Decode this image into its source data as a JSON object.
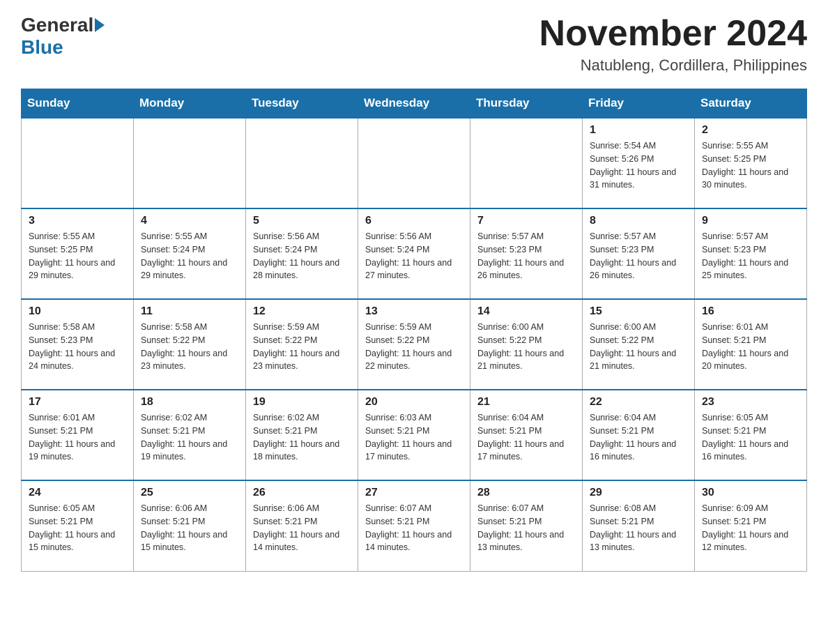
{
  "header": {
    "logo_general": "General",
    "logo_blue": "Blue",
    "month_title": "November 2024",
    "location": "Natubleng, Cordillera, Philippines"
  },
  "days_of_week": [
    "Sunday",
    "Monday",
    "Tuesday",
    "Wednesday",
    "Thursday",
    "Friday",
    "Saturday"
  ],
  "weeks": [
    [
      {
        "day": "",
        "sunrise": "",
        "sunset": "",
        "daylight": ""
      },
      {
        "day": "",
        "sunrise": "",
        "sunset": "",
        "daylight": ""
      },
      {
        "day": "",
        "sunrise": "",
        "sunset": "",
        "daylight": ""
      },
      {
        "day": "",
        "sunrise": "",
        "sunset": "",
        "daylight": ""
      },
      {
        "day": "",
        "sunrise": "",
        "sunset": "",
        "daylight": ""
      },
      {
        "day": "1",
        "sunrise": "Sunrise: 5:54 AM",
        "sunset": "Sunset: 5:26 PM",
        "daylight": "Daylight: 11 hours and 31 minutes."
      },
      {
        "day": "2",
        "sunrise": "Sunrise: 5:55 AM",
        "sunset": "Sunset: 5:25 PM",
        "daylight": "Daylight: 11 hours and 30 minutes."
      }
    ],
    [
      {
        "day": "3",
        "sunrise": "Sunrise: 5:55 AM",
        "sunset": "Sunset: 5:25 PM",
        "daylight": "Daylight: 11 hours and 29 minutes."
      },
      {
        "day": "4",
        "sunrise": "Sunrise: 5:55 AM",
        "sunset": "Sunset: 5:24 PM",
        "daylight": "Daylight: 11 hours and 29 minutes."
      },
      {
        "day": "5",
        "sunrise": "Sunrise: 5:56 AM",
        "sunset": "Sunset: 5:24 PM",
        "daylight": "Daylight: 11 hours and 28 minutes."
      },
      {
        "day": "6",
        "sunrise": "Sunrise: 5:56 AM",
        "sunset": "Sunset: 5:24 PM",
        "daylight": "Daylight: 11 hours and 27 minutes."
      },
      {
        "day": "7",
        "sunrise": "Sunrise: 5:57 AM",
        "sunset": "Sunset: 5:23 PM",
        "daylight": "Daylight: 11 hours and 26 minutes."
      },
      {
        "day": "8",
        "sunrise": "Sunrise: 5:57 AM",
        "sunset": "Sunset: 5:23 PM",
        "daylight": "Daylight: 11 hours and 26 minutes."
      },
      {
        "day": "9",
        "sunrise": "Sunrise: 5:57 AM",
        "sunset": "Sunset: 5:23 PM",
        "daylight": "Daylight: 11 hours and 25 minutes."
      }
    ],
    [
      {
        "day": "10",
        "sunrise": "Sunrise: 5:58 AM",
        "sunset": "Sunset: 5:23 PM",
        "daylight": "Daylight: 11 hours and 24 minutes."
      },
      {
        "day": "11",
        "sunrise": "Sunrise: 5:58 AM",
        "sunset": "Sunset: 5:22 PM",
        "daylight": "Daylight: 11 hours and 23 minutes."
      },
      {
        "day": "12",
        "sunrise": "Sunrise: 5:59 AM",
        "sunset": "Sunset: 5:22 PM",
        "daylight": "Daylight: 11 hours and 23 minutes."
      },
      {
        "day": "13",
        "sunrise": "Sunrise: 5:59 AM",
        "sunset": "Sunset: 5:22 PM",
        "daylight": "Daylight: 11 hours and 22 minutes."
      },
      {
        "day": "14",
        "sunrise": "Sunrise: 6:00 AM",
        "sunset": "Sunset: 5:22 PM",
        "daylight": "Daylight: 11 hours and 21 minutes."
      },
      {
        "day": "15",
        "sunrise": "Sunrise: 6:00 AM",
        "sunset": "Sunset: 5:22 PM",
        "daylight": "Daylight: 11 hours and 21 minutes."
      },
      {
        "day": "16",
        "sunrise": "Sunrise: 6:01 AM",
        "sunset": "Sunset: 5:21 PM",
        "daylight": "Daylight: 11 hours and 20 minutes."
      }
    ],
    [
      {
        "day": "17",
        "sunrise": "Sunrise: 6:01 AM",
        "sunset": "Sunset: 5:21 PM",
        "daylight": "Daylight: 11 hours and 19 minutes."
      },
      {
        "day": "18",
        "sunrise": "Sunrise: 6:02 AM",
        "sunset": "Sunset: 5:21 PM",
        "daylight": "Daylight: 11 hours and 19 minutes."
      },
      {
        "day": "19",
        "sunrise": "Sunrise: 6:02 AM",
        "sunset": "Sunset: 5:21 PM",
        "daylight": "Daylight: 11 hours and 18 minutes."
      },
      {
        "day": "20",
        "sunrise": "Sunrise: 6:03 AM",
        "sunset": "Sunset: 5:21 PM",
        "daylight": "Daylight: 11 hours and 17 minutes."
      },
      {
        "day": "21",
        "sunrise": "Sunrise: 6:04 AM",
        "sunset": "Sunset: 5:21 PM",
        "daylight": "Daylight: 11 hours and 17 minutes."
      },
      {
        "day": "22",
        "sunrise": "Sunrise: 6:04 AM",
        "sunset": "Sunset: 5:21 PM",
        "daylight": "Daylight: 11 hours and 16 minutes."
      },
      {
        "day": "23",
        "sunrise": "Sunrise: 6:05 AM",
        "sunset": "Sunset: 5:21 PM",
        "daylight": "Daylight: 11 hours and 16 minutes."
      }
    ],
    [
      {
        "day": "24",
        "sunrise": "Sunrise: 6:05 AM",
        "sunset": "Sunset: 5:21 PM",
        "daylight": "Daylight: 11 hours and 15 minutes."
      },
      {
        "day": "25",
        "sunrise": "Sunrise: 6:06 AM",
        "sunset": "Sunset: 5:21 PM",
        "daylight": "Daylight: 11 hours and 15 minutes."
      },
      {
        "day": "26",
        "sunrise": "Sunrise: 6:06 AM",
        "sunset": "Sunset: 5:21 PM",
        "daylight": "Daylight: 11 hours and 14 minutes."
      },
      {
        "day": "27",
        "sunrise": "Sunrise: 6:07 AM",
        "sunset": "Sunset: 5:21 PM",
        "daylight": "Daylight: 11 hours and 14 minutes."
      },
      {
        "day": "28",
        "sunrise": "Sunrise: 6:07 AM",
        "sunset": "Sunset: 5:21 PM",
        "daylight": "Daylight: 11 hours and 13 minutes."
      },
      {
        "day": "29",
        "sunrise": "Sunrise: 6:08 AM",
        "sunset": "Sunset: 5:21 PM",
        "daylight": "Daylight: 11 hours and 13 minutes."
      },
      {
        "day": "30",
        "sunrise": "Sunrise: 6:09 AM",
        "sunset": "Sunset: 5:21 PM",
        "daylight": "Daylight: 11 hours and 12 minutes."
      }
    ]
  ]
}
